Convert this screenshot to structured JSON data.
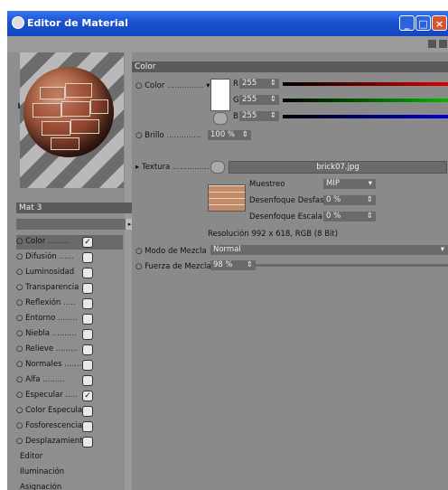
{
  "window": {
    "title": "Editor de Material"
  },
  "material": {
    "name": "Mat 3"
  },
  "channels": [
    {
      "label": "Color",
      "checked": true
    },
    {
      "label": "Difusión",
      "checked": false
    },
    {
      "label": "Luminosidad",
      "checked": false
    },
    {
      "label": "Transparencia",
      "checked": false
    },
    {
      "label": "Reflexión",
      "checked": false
    },
    {
      "label": "Entorno",
      "checked": false
    },
    {
      "label": "Niebla",
      "checked": false
    },
    {
      "label": "Relieve",
      "checked": false
    },
    {
      "label": "Normales",
      "checked": false
    },
    {
      "label": "Alfa",
      "checked": false
    },
    {
      "label": "Especular",
      "checked": true
    },
    {
      "label": "Color Especular",
      "checked": false
    },
    {
      "label": "Fosforescencia",
      "checked": false
    },
    {
      "label": "Desplazamiento",
      "checked": false
    }
  ],
  "extra_items": [
    "Editor",
    "Iluminación",
    "Asignación"
  ],
  "section": {
    "title": "Color"
  },
  "color": {
    "label": "Color",
    "r_label": "R",
    "r_value": "255",
    "g_label": "G",
    "g_value": "255",
    "b_label": "B",
    "b_value": "255",
    "swatch": "#ffffff"
  },
  "brillo": {
    "label": "Brillo",
    "value": "100 %"
  },
  "textura": {
    "label": "Textura",
    "file": "brick07.jpg",
    "muestreo_label": "Muestreo",
    "muestreo_value": "MIP",
    "desenfoque_desfase_label": "Desenfoque Desfase",
    "desenfoque_desfase_value": "0 %",
    "desenfoque_escala_label": "Desenfoque Escala",
    "desenfoque_escala_value": "0 %",
    "resolucion": "Resolución 992 x 618, RGB (8 Bit)"
  },
  "modo_mezcla": {
    "label": "Modo de Mezcla",
    "value": "Normal"
  },
  "fuerza_mezcla": {
    "label": "Fuerza de Mezcla",
    "value": "98 %"
  }
}
